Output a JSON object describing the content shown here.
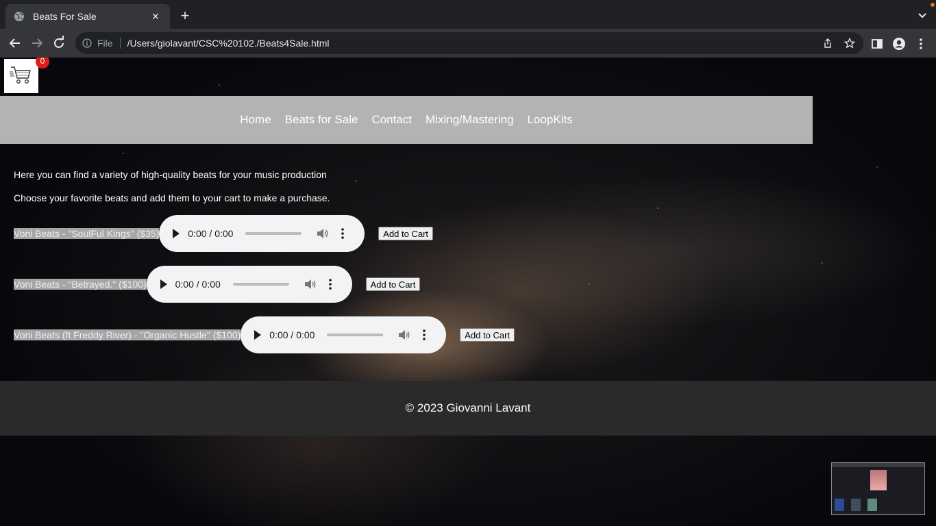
{
  "browser": {
    "tab_title": "Beats For Sale",
    "new_tab": "+",
    "close": "×",
    "scheme": "File",
    "url": "/Users/giolavant/CSC%20102./Beats4Sale.html"
  },
  "cart": {
    "count": "0",
    "icon": "shopping-cart-icon"
  },
  "nav": {
    "items": [
      "Home",
      "Beats for Sale",
      "Contact",
      "Mixing/Mastering",
      "LoopKits"
    ]
  },
  "intro": {
    "line1": "Here you can find a variety of high-quality beats for your music production",
    "line2": "Choose your favorite beats and add them to your cart to make a purchase."
  },
  "beats": [
    {
      "label": "Voni Beats - \"SoulFul Kings\" ($35)",
      "time": "0:00 / 0:00",
      "button": "Add to Cart"
    },
    {
      "label": "Voni Beats - \"Betrayed.\" ($100)",
      "time": "0:00 / 0:00",
      "button": "Add to Cart"
    },
    {
      "label": "Voni Beats (ft Freddy River) - \"Organic Hustle\" ($100)",
      "time": "0:00 / 0:00",
      "button": "Add to Cart"
    }
  ],
  "footer": {
    "text": "© 2023 Giovanni Lavant"
  },
  "colors": {
    "nav_bg": "#b3b3b3",
    "footer_bg": "#2a2a2a",
    "badge": "#e21b1b"
  }
}
